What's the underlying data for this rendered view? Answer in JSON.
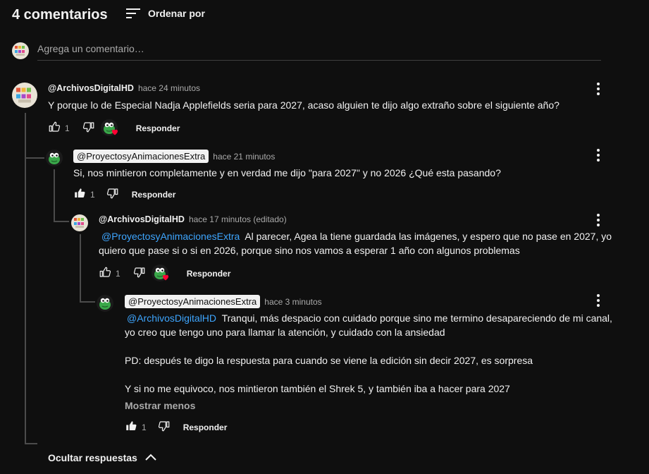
{
  "header": {
    "count_label": "4 comentarios",
    "sort_label": "Ordenar por"
  },
  "add_comment": {
    "placeholder": "Agrega un comentario…"
  },
  "comments": [
    {
      "author": "@ArchivosDigitalHD",
      "time": "hace 24 minutos",
      "text": "Y porque lo de Especial Nadja Applefields seria para 2027, acaso alguien te dijo algo extraño sobre el siguiente año?",
      "likes": "1",
      "reply_label": "Responder"
    },
    {
      "author": "@ProyectosyAnimacionesExtra",
      "time": "hace 21 minutos",
      "text": "Si, nos mintieron completamente y en verdad me dijo \"para 2027\" y no 2026 ¿Qué esta pasando?",
      "likes": "1",
      "reply_label": "Responder"
    },
    {
      "author": "@ArchivosDigitalHD",
      "time": "hace 17 minutos (editado)",
      "mention": "@ProyectosyAnimacionesExtra",
      "text_line1": "Al parecer, Agea la tiene guardada las imágenes, y espero que no pase en 2027, yo",
      "text_line2": "quiero que pase si o si en 2026, porque sino nos vamos a esperar 1 año con algunos problemas",
      "likes": "1",
      "reply_label": "Responder"
    },
    {
      "author": "@ProyectosyAnimacionesExtra",
      "time": "hace 3 minutos",
      "mention": "@ArchivosDigitalHD",
      "text_line1": "Tranqui, más despacio con cuidado porque sino me termino desapareciendo de mi canal,",
      "text_line2": "yo creo que tengo uno para llamar la atención, y cuidado con la ansiedad",
      "text_p2": "PD: después te digo la respuesta para cuando se viene la edición sin decir 2027, es sorpresa",
      "text_p3": "Y si no me equivoco, nos mintieron también el Shrek 5, y también iba a hacer para 2027",
      "show_less": "Mostrar menos",
      "likes": "1",
      "reply_label": "Responder"
    }
  ],
  "hide_replies": "Ocultar respuestas",
  "colors": {
    "background": "#0f0f0f",
    "text": "#f1f1f1",
    "secondary": "#aaaaaa",
    "link": "#3ea6ff",
    "heart": "#ff0033"
  },
  "icons": [
    "sort-icon",
    "like-icon",
    "dislike-icon",
    "more-vert-icon",
    "creator-heart-icon",
    "chevron-up-icon"
  ]
}
